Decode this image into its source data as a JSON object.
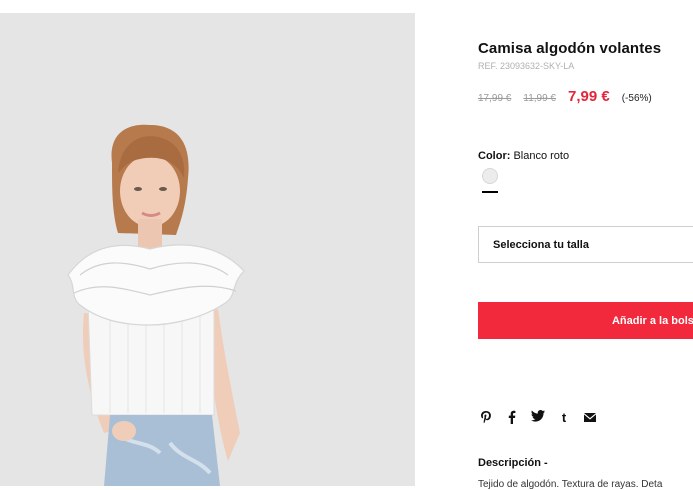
{
  "product": {
    "title": "Camisa algodón volantes",
    "ref": "REF. 23093632-SKY-LA",
    "price_original": "17,99 €",
    "price_previous": "11,99 €",
    "price_current": "7,99 €",
    "discount": "(-56%)"
  },
  "color": {
    "label": "Color:",
    "value": "Blanco roto",
    "swatch_color": "#ececec"
  },
  "size_select": {
    "label": "Selecciona tu talla"
  },
  "cart": {
    "add_label": "Añadir a la bolsa",
    "button_color": "#f2283d"
  },
  "share": {
    "icons": [
      "pinterest-icon",
      "facebook-icon",
      "twitter-icon",
      "tumblr-icon",
      "email-icon"
    ]
  },
  "description": {
    "title": "Descripción -",
    "text": "Tejido de algodón. Textura de rayas. Deta"
  }
}
